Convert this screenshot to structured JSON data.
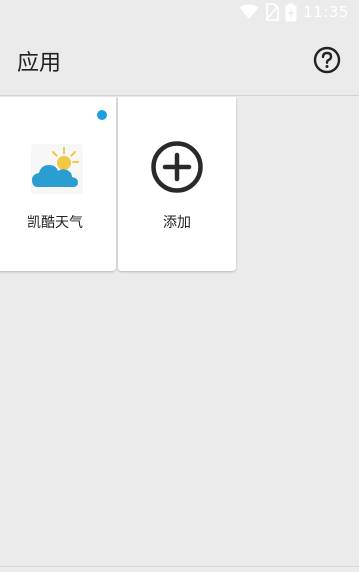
{
  "status_bar": {
    "time": "11:35",
    "icons": [
      "wifi-icon",
      "no-sim-icon",
      "battery-charging-icon"
    ]
  },
  "app_bar": {
    "title": "应用",
    "help_icon": "help-circle-icon"
  },
  "apps": [
    {
      "label": "凯酷天气",
      "icon": "weather-sun-cloud-icon",
      "has_badge": true
    },
    {
      "label": "添加",
      "icon": "add-circle-icon",
      "has_badge": false
    }
  ],
  "colors": {
    "background": "#ebebeb",
    "badge": "#1a9fe0",
    "cloud": "#2b9ed1",
    "sun": "#f2c744"
  }
}
